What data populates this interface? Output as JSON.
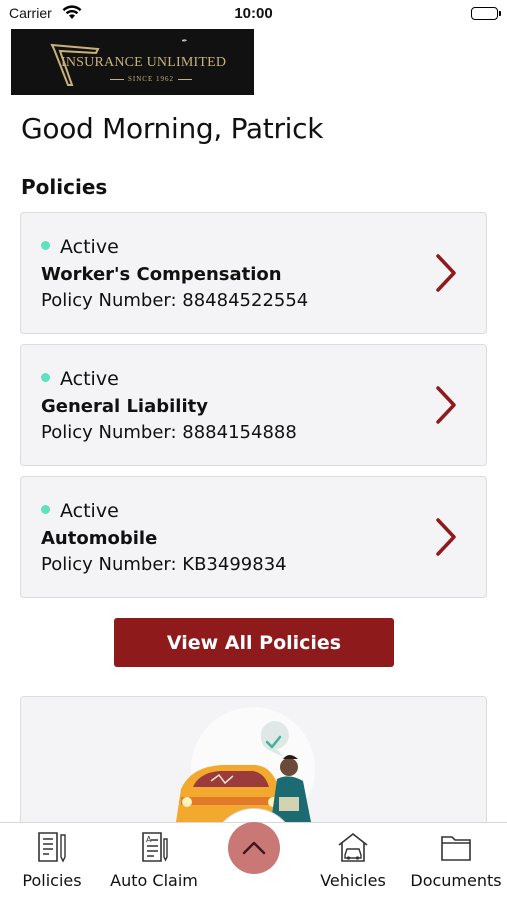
{
  "status_bar": {
    "carrier": "Carrier",
    "time": "10:00"
  },
  "logo": {
    "name": "INSURANCE UNLIMITED",
    "tagline": "SINCE 1962",
    "script": "Jenkins"
  },
  "greeting": "Good Morning, Patrick",
  "policies_section": {
    "title": "Policies",
    "items": [
      {
        "status": "Active",
        "type": "Worker's Compensation",
        "number": "Policy Number: 88484522554"
      },
      {
        "status": "Active",
        "type": "General Liability",
        "number": "Policy Number: 8884154888"
      },
      {
        "status": "Active",
        "type": "Automobile",
        "number": "Policy Number: KB3499834"
      }
    ],
    "view_all_label": "View All Policies"
  },
  "tab_bar": {
    "tabs": [
      {
        "label": "Policies",
        "icon": "policy-document-icon"
      },
      {
        "label": "Auto Claim",
        "icon": "claim-form-icon"
      },
      {
        "label": "Vehicles",
        "icon": "vehicle-garage-icon"
      },
      {
        "label": "Documents",
        "icon": "folder-icon"
      }
    ],
    "center_button_icon": "chevron-up-icon"
  },
  "colors": {
    "accent": "#8e1a1c",
    "status_active": "#5fe0c0",
    "card_bg": "#f4f4f6",
    "fab": "#c97876"
  }
}
